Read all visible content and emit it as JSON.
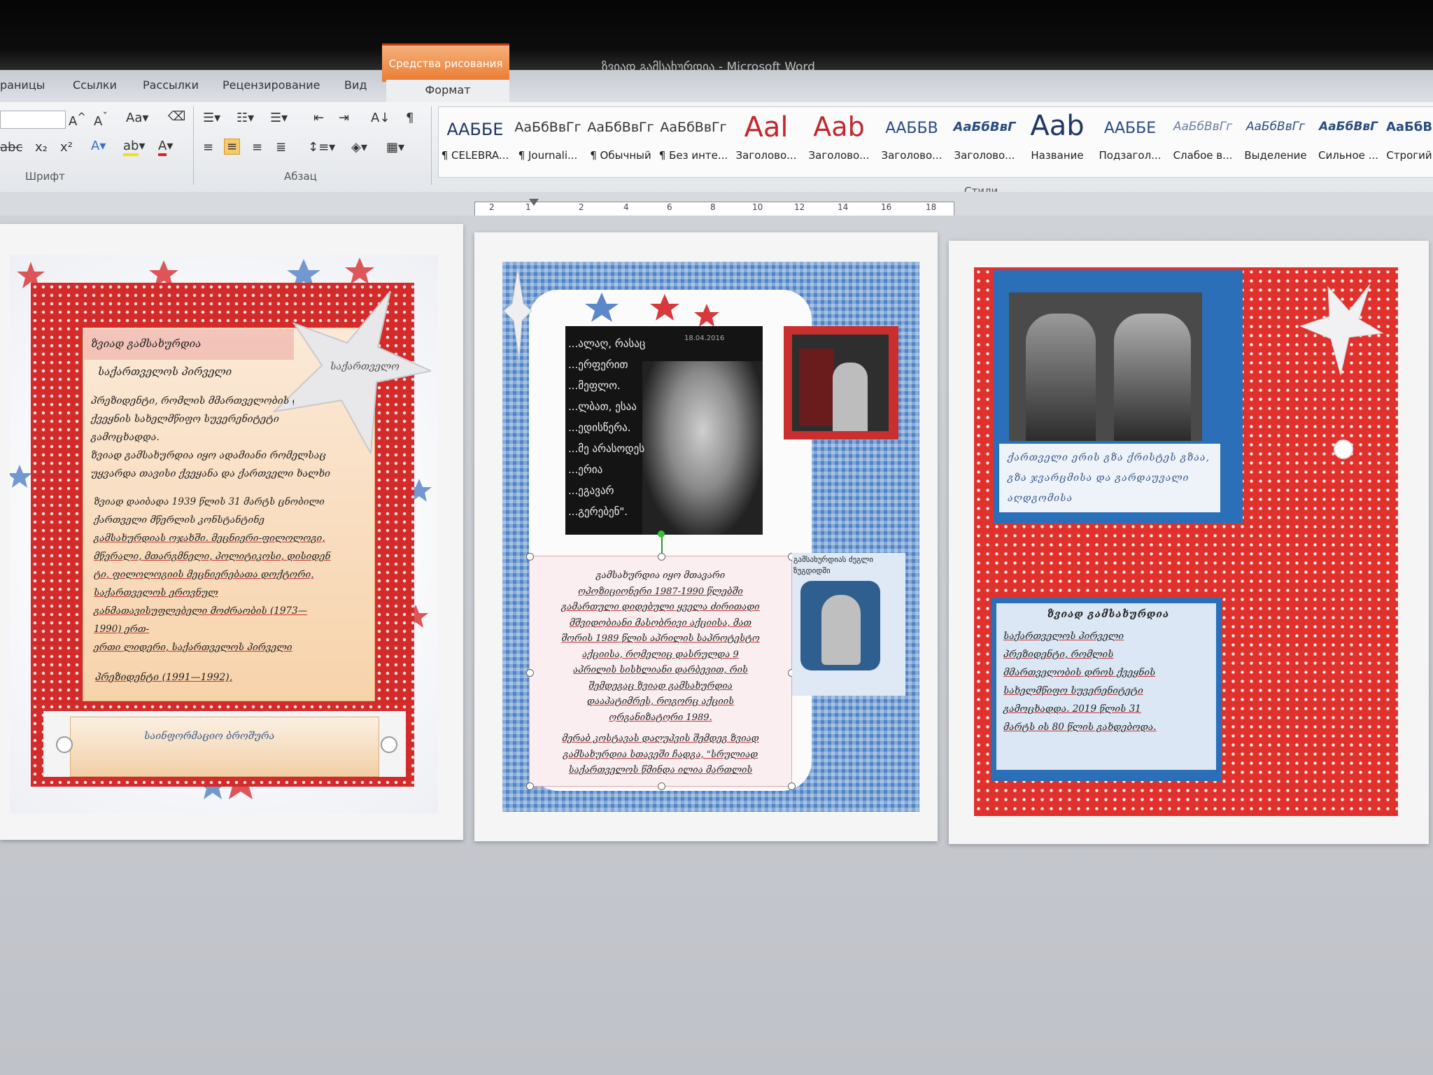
{
  "window": {
    "title": "ზვიად გამსახურდია - Microsoft Word"
  },
  "tabs": [
    "раницы",
    "Ссылки",
    "Рассылки",
    "Рецензирование",
    "Вид"
  ],
  "contextual": {
    "group": "Средства рисования",
    "tab": "Формат"
  },
  "ribbon": {
    "font_group_label": "Шрифт",
    "paragraph_group_label": "Абзац",
    "styles_group_label": "Стили",
    "styles": [
      {
        "sample": "ААББЕ",
        "name": "¶ CELEBRA..."
      },
      {
        "sample": "АаБбВвГг",
        "name": "¶ Journali..."
      },
      {
        "sample": "АаБбВвГг",
        "name": "¶ Обычный"
      },
      {
        "sample": "АаБбВвГг",
        "name": "¶ Без инте..."
      },
      {
        "sample": "Aal",
        "name": "Заголово..."
      },
      {
        "sample": "Aab",
        "name": "Заголово..."
      },
      {
        "sample": "ААББВ",
        "name": "Заголово..."
      },
      {
        "sample": "АаБбВвГ",
        "name": "Заголово..."
      },
      {
        "sample": "Aab",
        "name": "Название"
      },
      {
        "sample": "ААББЕ",
        "name": "Подзагол..."
      },
      {
        "sample": "АаБбВвГг",
        "name": "Слабое в..."
      },
      {
        "sample": "АаБбВвГг",
        "name": "Выделение"
      },
      {
        "sample": "АаБбВвГ",
        "name": "Сильное ..."
      },
      {
        "sample": "АаБбВ",
        "name": "Строгий"
      }
    ]
  },
  "ruler": [
    "2",
    "1",
    "2",
    "4",
    "6",
    "8",
    "10",
    "12",
    "14",
    "16",
    "18"
  ],
  "page1": {
    "title": "ზვიად გამსახურდია",
    "subtitle": "საქართველოს პირველი",
    "star_label": "საქართველო",
    "lines": [
      "პრეზიდენტი, რომლის მმართველობის დროს",
      "ქვეყნის სახელმწიფო სუვერენიტეტი",
      "გამოცხადდა.",
      "ზვიად გამსახურდია იყო ადამიანი რომელსაც",
      "უყვარდა თავისი ქვეყანა და ქართველი ხალხი"
    ],
    "lines2": [
      "ზვიად დაიბადა 1939 წლის 31 მარტს ცნობილი",
      "ქართველი მწერლის კონსტანტინე",
      "გამსახურდიას ოჯახში. მეცნიერი-ფილოლოგი,",
      "მწერალი, მთარგმნელი, პოლიტიკოსი, დისიდენ",
      "ტი, ფილოლოგიის მეცნიერებათა დოქტორი,",
      "საქართველოს ეროვნულ",
      "განმათავისუფლებელი მოძრაობის (1973—",
      "1990) ერთ-",
      "ერთი ლიდერი, საქართველოს პირველი"
    ],
    "president_line": "პრეზიდენტი (1991—1992),",
    "footer": "საინფორმაციო ბროშურა"
  },
  "page2": {
    "quote_lines": [
      "...ალაღ, რასაც",
      "...ერფერით",
      "...მეფლო.",
      "...ლბათ, ესაა",
      "...ედისწერა.",
      "...მე არასოდეს",
      "...ერია",
      "...ეგავარ",
      "...გერებენ\"."
    ],
    "photo_date": "18.04.2016",
    "caption_side": "გამსახურდიას ძეგლი ზუგდიდში",
    "text_lines": [
      "გამსახურდია იყო მთავარი",
      "ოპოზიციონერი 1987-1990 წლებში",
      "გამართული დიდებული ყველა ძირითადი",
      "მშვიდობიანი მასობრივი აქციისა, მათ",
      "შორის 1989 წლის აპრილის საპროტესტო",
      "აქციისა, რომელიც დასრულდა 9",
      "აპრილის სისხლიანი დარბევით, რის",
      "შემდეგაც ზვიად გამსახურდია",
      "დააპატიმრეს, როგორც აქციის",
      "ორგანიზატორი 1989.",
      "",
      "მერაბ კოსტავას დაღუპვის შემდეგ ზვიად",
      "გამსახურდია სთავეში ჩადგა, \"სრულიად",
      "საქართველოს წმინდა ილია მართლის"
    ]
  },
  "page3": {
    "quote": "ქართველი ერის გზა ქრისტეს გზაა, გზა ჯვარცმისა და გარდაუვალი აღდგომისა",
    "title": "ზვიად გამსახურდია",
    "lines": [
      "საქართველოს პირველი",
      "პრეზიდენტი, რომლის",
      "მმართველობის დროს ქვეყნის",
      "სახელმწიფო სუვერენიტეტი",
      "გამოცხადდა. 2019 წლის 31",
      "მარტს ის 80 წლის გახდებოდა."
    ]
  }
}
